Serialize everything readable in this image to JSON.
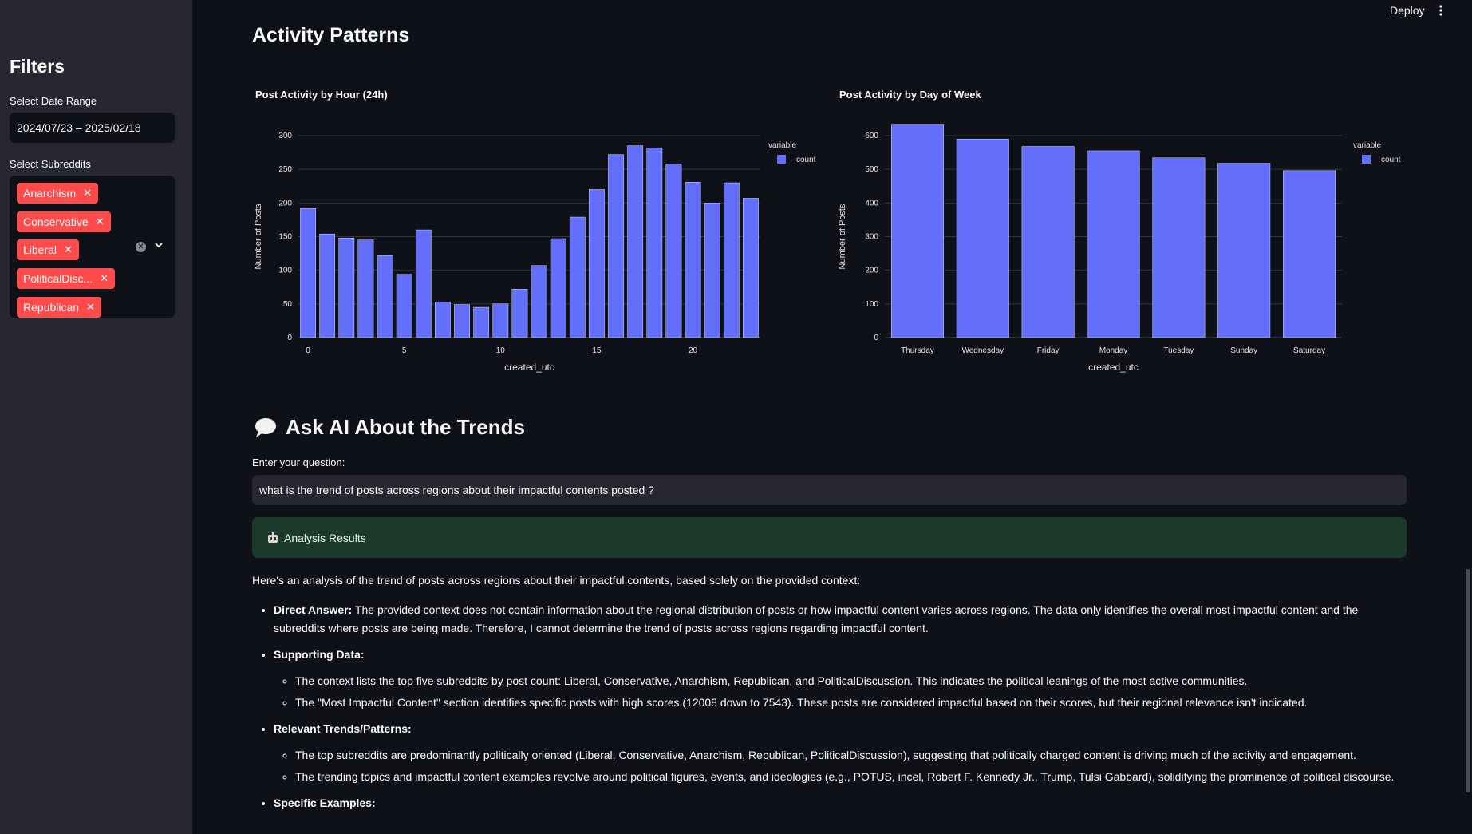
{
  "app": {
    "deploy_label": "Deploy"
  },
  "sidebar": {
    "title": "Filters",
    "date_label": "Select Date Range",
    "date_value": "2024/07/23 – 2025/02/18",
    "subreddit_label": "Select Subreddits",
    "tags": [
      "Anarchism",
      "Conservative",
      "Liberal",
      "PoliticalDisc...",
      "Republican"
    ],
    "tag_remove": "✕"
  },
  "main": {
    "title": "Activity Patterns",
    "ask_title": "Ask AI About the Trends",
    "question_label": "Enter your question:",
    "question_value": "what is the trend of posts across regions about their impactful contents posted ?",
    "results_label": "Analysis Results",
    "answer_intro": "Here's an analysis of the trend of posts across regions about their impactful contents, based solely on the provided context:",
    "direct_answer_label": "Direct Answer:",
    "direct_answer_text": " The provided context does not contain information about the regional distribution of posts or how impactful content varies across regions. The data only identifies the overall most impactful content and the subreddits where posts are being made. Therefore, I cannot determine the trend of posts across regions regarding impactful content.",
    "supporting_label": "Supporting Data:",
    "supporting_items": [
      "The context lists the top five subreddits by post count: Liberal, Conservative, Anarchism, Republican, and PoliticalDiscussion. This indicates the political leanings of the most active communities.",
      "The \"Most Impactful Content\" section identifies specific posts with high scores (12008 down to 7543). These posts are considered impactful based on their scores, but their regional relevance isn't indicated."
    ],
    "trends_label": "Relevant Trends/Patterns:",
    "trends_items": [
      "The top subreddits are predominantly politically oriented (Liberal, Conservative, Anarchism, Republican, PoliticalDiscussion), suggesting that politically charged content is driving much of the activity and engagement.",
      "The trending topics and impactful content examples revolve around political figures, events, and ideologies (e.g., POTUS, incel, Robert F. Kennedy Jr., Trump, Tulsi Gabbard), solidifying the prominence of political discourse."
    ],
    "examples_label": "Specific Examples:"
  },
  "chart_data": [
    {
      "type": "bar",
      "title": "Post Activity by Hour (24h)",
      "xlabel": "created_utc",
      "ylabel": "Number of Posts",
      "legend_title": "variable",
      "x": [
        0,
        1,
        2,
        3,
        4,
        5,
        6,
        7,
        8,
        9,
        10,
        11,
        12,
        13,
        14,
        15,
        16,
        17,
        18,
        19,
        20,
        21,
        22,
        23
      ],
      "series": [
        {
          "name": "count",
          "values": [
            192,
            154,
            148,
            145,
            122,
            94,
            160,
            53,
            49,
            45,
            50,
            72,
            107,
            147,
            179,
            220,
            272,
            285,
            282,
            258,
            231,
            200,
            230,
            207
          ]
        }
      ],
      "xticks": [
        0,
        5,
        10,
        15,
        20
      ],
      "yticks": [
        0,
        50,
        100,
        150,
        200,
        250,
        300
      ],
      "ylim": [
        0,
        300
      ],
      "xlim": [
        -0.5,
        23.5
      ],
      "color": "#636efa",
      "legend_position": "top-right"
    },
    {
      "type": "bar",
      "title": "Post Activity by Day of Week",
      "xlabel": "created_utc",
      "ylabel": "Number of Posts",
      "legend_title": "variable",
      "categories": [
        "Thursday",
        "Wednesday",
        "Friday",
        "Monday",
        "Tuesday",
        "Sunday",
        "Saturday"
      ],
      "series": [
        {
          "name": "count",
          "values": [
            634,
            590,
            568,
            555,
            534,
            518,
            496
          ]
        }
      ],
      "yticks": [
        0,
        100,
        200,
        300,
        400,
        500,
        600
      ],
      "ylim": [
        0,
        600
      ],
      "color": "#636efa",
      "legend_position": "top-right"
    }
  ],
  "colors": {
    "accent": "#ff4b4b",
    "bar": "#636efa",
    "success_bg": "#1b3a2b",
    "background": "#0e1117",
    "sidebar": "#262730"
  },
  "icons": {
    "speech": "speech-bubble-icon",
    "results": "robot-icon",
    "more": "more-vertical-icon",
    "clear": "clear-icon",
    "chevron": "chevron-down-icon"
  }
}
